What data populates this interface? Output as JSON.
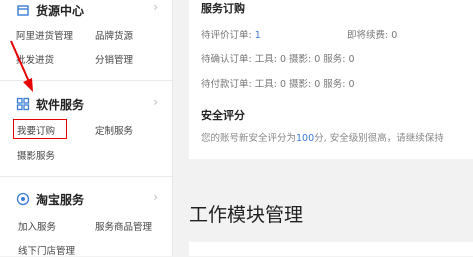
{
  "sidebar": {
    "supply": {
      "title": "货源中心",
      "links": [
        "阿里进货管理",
        "品牌货源",
        "批发进货",
        "分销管理"
      ]
    },
    "software": {
      "title": "软件服务",
      "links": [
        "我要订购",
        "定制服务",
        "摄影服务"
      ]
    },
    "taobao": {
      "title": "淘宝服务",
      "links": [
        "加入服务",
        "服务商品管理",
        "线下门店管理"
      ]
    }
  },
  "orders": {
    "title": "服务订购",
    "row1": {
      "pending_review": "待评价订单:",
      "pending_review_count": "1",
      "renew": "即将续费: 0"
    },
    "row2": {
      "label": "待确认订单:",
      "text": "工具: 0  摄影: 0  服务: 0"
    },
    "row3": {
      "label": "待付款订单:",
      "text": "工具: 0  摄影: 0  服务: 0"
    }
  },
  "security": {
    "title": "安全评分",
    "prefix": "您的账号新安全评分为",
    "score": "100",
    "suffix": "分, 安全级别很高，请继续保持"
  },
  "module": {
    "title": "工作模块管理"
  },
  "colors": {
    "highlight": "#e60000",
    "link_blue": "#3b7cd6"
  }
}
